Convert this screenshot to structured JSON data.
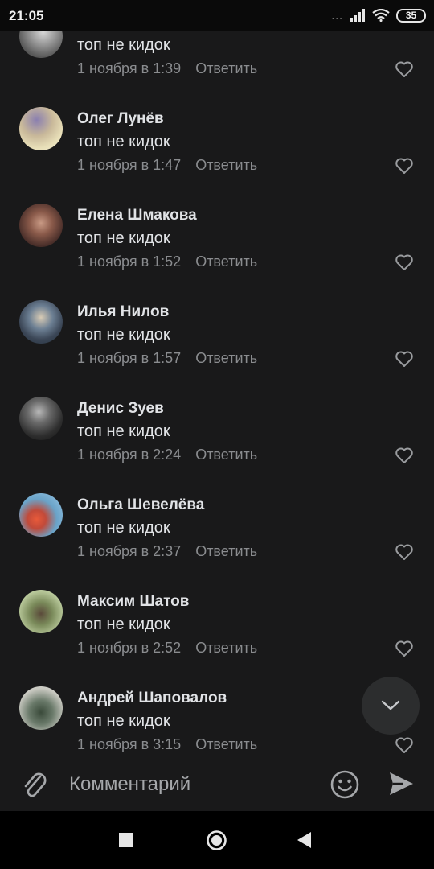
{
  "status": {
    "time": "21:05",
    "battery": "35",
    "signal_dots": "..."
  },
  "comments": [
    {
      "name": "",
      "text": "топ не кидок",
      "date": "1 ноября в 1:39",
      "reply": "Ответить",
      "avatar": "avatar-photo-partial"
    },
    {
      "name": "Олег Лунёв",
      "text": "топ не кидок",
      "date": "1 ноября в 1:47",
      "reply": "Ответить",
      "avatar": "avatar-photo"
    },
    {
      "name": "Елена Шмакова",
      "text": "топ не кидок",
      "date": "1 ноября в 1:52",
      "reply": "Ответить",
      "avatar": "avatar-photo"
    },
    {
      "name": "Илья Нилов",
      "text": "топ не кидок",
      "date": "1 ноября в 1:57",
      "reply": "Ответить",
      "avatar": "avatar-photo"
    },
    {
      "name": "Денис Зуев",
      "text": "топ не кидок",
      "date": "1 ноября в 2:24",
      "reply": "Ответить",
      "avatar": "avatar-photo"
    },
    {
      "name": "Ольга Шевелёва",
      "text": "топ не кидок",
      "date": "1 ноября в 2:37",
      "reply": "Ответить",
      "avatar": "avatar-photo"
    },
    {
      "name": "Максим Шатов",
      "text": "топ не кидок",
      "date": "1 ноября в 2:52",
      "reply": "Ответить",
      "avatar": "avatar-photo"
    },
    {
      "name": "Андрей Шаповалов",
      "text": "топ не кидок",
      "date": "1 ноября в 3:15",
      "reply": "Ответить",
      "avatar": "avatar-photo"
    }
  ],
  "composer": {
    "placeholder": "Комментарий"
  },
  "icons": {
    "like": "heart-outline-icon",
    "scroll_down": "chevron-down-icon",
    "attach": "paperclip-icon",
    "emoji": "smile-icon",
    "send": "send-icon",
    "nav_recents": "square-icon",
    "nav_home": "circle-icon",
    "nav_back": "triangle-back-icon"
  },
  "colors": {
    "background": "#19191a",
    "text_primary": "#e1e3e6",
    "text_secondary": "#8a8c8f",
    "fab_background": "#2c2d2e",
    "status_bar": "#0a0a0a",
    "nav_bar": "#000000"
  }
}
